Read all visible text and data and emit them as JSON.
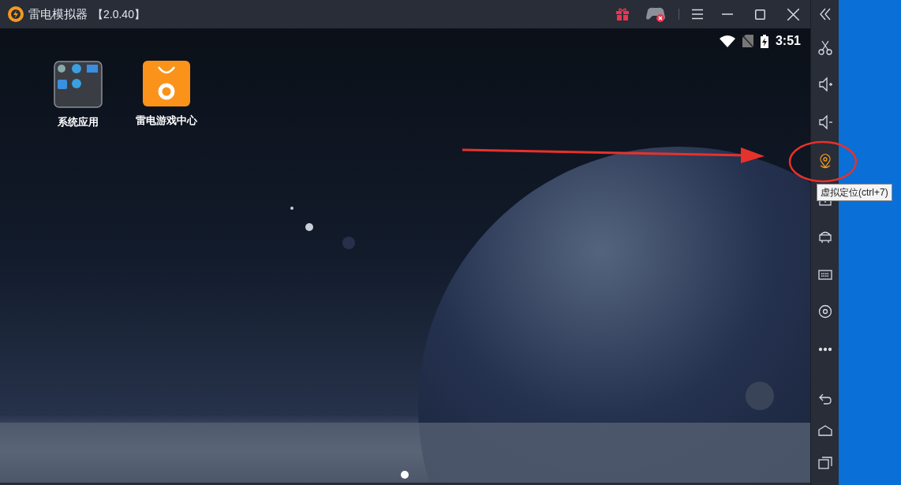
{
  "window": {
    "title": "雷电模拟器",
    "version": "【2.0.40】"
  },
  "status_bar": {
    "time": "3:51"
  },
  "desktop_icons": [
    {
      "kind": "folder",
      "label": "系统应用"
    },
    {
      "kind": "app",
      "label": "雷电游戏中心"
    }
  ],
  "sidebar": {
    "items": [
      {
        "kind": "collapse",
        "selected": false
      },
      {
        "kind": "scissors",
        "selected": false
      },
      {
        "kind": "volume-up",
        "selected": false
      },
      {
        "kind": "volume-down",
        "selected": false
      },
      {
        "kind": "location",
        "selected": true
      },
      {
        "kind": "screen",
        "selected": false
      },
      {
        "kind": "apk",
        "selected": false
      },
      {
        "kind": "keyboard",
        "selected": false
      },
      {
        "kind": "settings",
        "selected": false
      },
      {
        "kind": "more",
        "selected": false
      }
    ],
    "nav": [
      {
        "kind": "back"
      },
      {
        "kind": "home"
      },
      {
        "kind": "recents"
      }
    ]
  },
  "tooltip": "虚拟定位(ctrl+7)"
}
